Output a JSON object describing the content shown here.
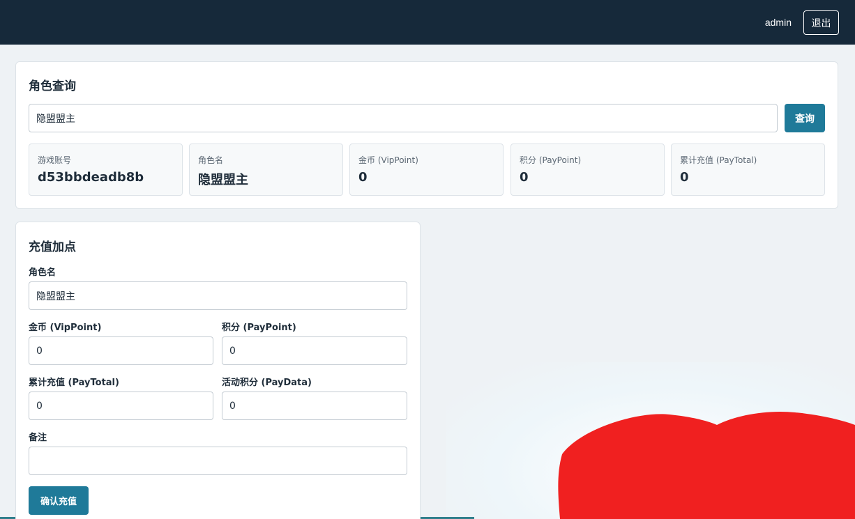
{
  "header": {
    "username": "admin",
    "logout_label": "退出"
  },
  "query": {
    "title": "角色查询",
    "search_value": "隐盟盟主",
    "search_button": "查询",
    "stats": [
      {
        "label": "游戏账号",
        "value": "d53bbdeadb8b"
      },
      {
        "label": "角色名",
        "value": "隐盟盟主"
      },
      {
        "label": "金币 (VipPoint)",
        "value": "0"
      },
      {
        "label": "积分 (PayPoint)",
        "value": "0"
      },
      {
        "label": "累计充值 (PayTotal)",
        "value": "0"
      }
    ]
  },
  "recharge": {
    "title": "充值加点",
    "role_label": "角色名",
    "role_value": "隐盟盟主",
    "vip_label": "金币 (VipPoint)",
    "vip_value": "0",
    "paypoint_label": "积分 (PayPoint)",
    "paypoint_value": "0",
    "paytotal_label": "累计充值 (PayTotal)",
    "paytotal_value": "0",
    "paydata_label": "活动积分 (PayData)",
    "paydata_value": "0",
    "remark_label": "备注",
    "remark_value": "",
    "confirm_button": "确认充值"
  },
  "colors": {
    "header_bg": "#16293a",
    "primary": "#1f7a99",
    "page_bg": "#eef2f5",
    "decor_red": "#f02020"
  }
}
